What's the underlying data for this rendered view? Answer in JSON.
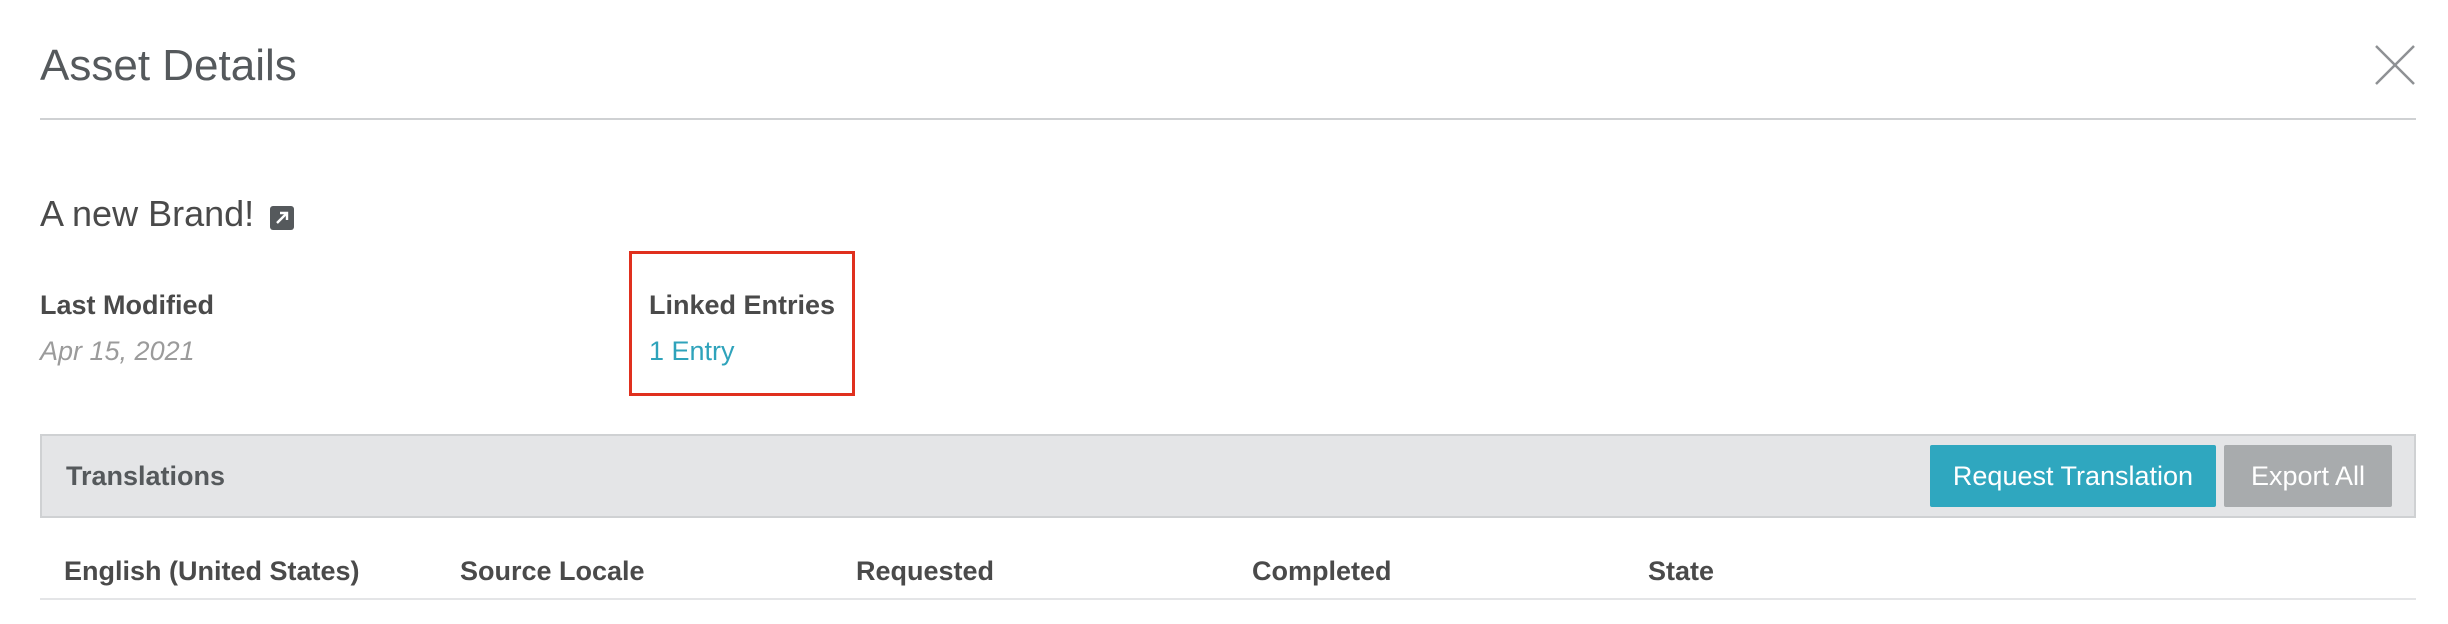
{
  "header": {
    "title": "Asset Details",
    "close_icon": "close-icon"
  },
  "asset": {
    "name": "A new Brand!",
    "external_link_icon": "external-link-icon"
  },
  "meta": {
    "last_modified_label": "Last Modified",
    "last_modified_value": "Apr 15, 2021",
    "linked_entries_label": "Linked Entries",
    "linked_entries_value": "1 Entry"
  },
  "translations": {
    "title": "Translations",
    "request_button": "Request Translation",
    "export_button": "Export All"
  },
  "table": {
    "columns": [
      "English (United States)",
      "Source Locale",
      "Requested",
      "Completed",
      "State"
    ]
  },
  "colors": {
    "accent": "#2fa7bf",
    "link": "#2fa3bb",
    "secondary_button": "#a8abad",
    "highlight": "#e0301e",
    "bar_background": "#e4e5e7"
  }
}
